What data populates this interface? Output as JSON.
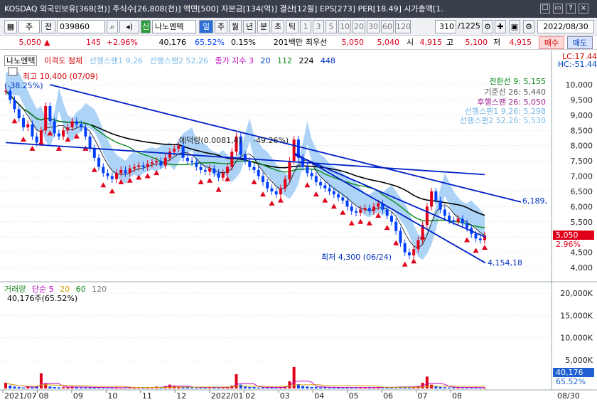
{
  "window": {
    "title": "KOSDAQ 외국인보유[368(천)] 주식수[26,808(천)] 액면[500] 자본금[134(억)] 결산[12월] EPS[273] PER[18.49] 시가총액[1.",
    "buttons": [
      "☐",
      "▭",
      "?",
      "×"
    ]
  },
  "toolbar": {
    "market": "주",
    "period_btn": "전",
    "code": "039860",
    "stock_name": "나노엔텍",
    "credit": "신",
    "mode_buttons": [
      "일",
      "주",
      "월",
      "년",
      "분",
      "초",
      "틱"
    ],
    "intervals": [
      "1",
      "3",
      "5",
      "10",
      "20",
      "30",
      "60",
      "120"
    ],
    "count": "310",
    "total": "/1225",
    "date": "2022/08/30"
  },
  "quote": {
    "price": "5,050",
    "change_arrow": "▲",
    "change": "145",
    "change_pct": "+2.96%",
    "volume": "40,176",
    "vol_ratio": "65.52%",
    "turnover": "0.15%",
    "amount": "201백만",
    "best_ask_label": "최우선",
    "best_ask": "5,050",
    "best_bid": "5,040",
    "open_label": "시",
    "open": "4,915",
    "high_label": "고",
    "high": "5,100",
    "low_label": "저",
    "low": "4,915",
    "buy_label": "매수",
    "sell_label": "매도"
  },
  "legend": {
    "stock": "나노엔텍",
    "overlay": "이격도 첨체",
    "span1": "선행스팬1 9,26",
    "span2": "선행스팬2 52,26",
    "ma_label": "종가 지수 3",
    "ma_periods": [
      "20",
      "112",
      "224",
      "448"
    ]
  },
  "stats": {
    "lc": "LC:17.44",
    "hc": "HC:-51.44"
  },
  "ichimoku_legend": [
    {
      "label": "전환선 9: 5,155",
      "color": "#0a8a1a"
    },
    {
      "label": "기준선 26: 5,440",
      "color": "#555555"
    },
    {
      "label": "후행스팬 26: 5,050",
      "color": "#9b1f8a"
    },
    {
      "label": "선행스팬1 9,26: 5,298",
      "color": "#7ab8e8"
    },
    {
      "label": "선행스팬2 52,26: 5,530",
      "color": "#7ab8e8"
    }
  ],
  "annotations": {
    "max": "최고 10,400 (07/09)",
    "max_pct": "(-38.25%)",
    "min": "최저 4,300 (06/24)",
    "trend_top": "6,189,",
    "trend_bottom": "4,154,18",
    "midlabel": "에덕량(0.0081,4)",
    "midpct": "-49.26%)",
    "last_price": "5,050",
    "last_pct": "2.96%"
  },
  "volume_panel": {
    "title": "거래량",
    "ma_label": "단순 5",
    "periods": [
      "20",
      "60",
      "120"
    ],
    "current": "40,176주(65.52%)",
    "last_volume": "40,176",
    "last_pct": "65.52%"
  },
  "colors": {
    "up": "#e0001a",
    "down": "#0040ff",
    "cloud": "#6ab0f0",
    "ma20": "#0a0a0a",
    "ma112": "#0a8a1a",
    "ma224": "#000000",
    "trend": "#0020c8"
  },
  "chart_data": {
    "type": "candlestick",
    "price_axis": {
      "min": 4000,
      "max": 10000,
      "ticks": [
        "10,000",
        "9,500",
        "9,000",
        "8,500",
        "8,000",
        "7,500",
        "7,000",
        "6,500",
        "6,000",
        "5,500",
        "5,000",
        "4,500",
        "4,000"
      ]
    },
    "volume_axis": {
      "ticks": [
        "20,000K",
        "15,000K",
        "10,000K",
        "5,000K"
      ]
    },
    "x_ticks": [
      "2021/07",
      "08",
      "09",
      "10",
      "11",
      "12",
      "2022/01",
      "02",
      "03",
      "04",
      "05",
      "06",
      "07",
      "08",
      "08/30"
    ],
    "close": [
      9800,
      9500,
      9200,
      8900,
      8600,
      8700,
      8300,
      8100,
      8500,
      9300,
      8800,
      8400,
      8300,
      8500,
      8600,
      8800,
      8700,
      8600,
      8300,
      7900,
      7600,
      7300,
      7100,
      7000,
      6900,
      7100,
      7200,
      7100,
      7250,
      7300,
      7350,
      7300,
      7400,
      7450,
      7500,
      7350,
      7600,
      7800,
      7900,
      8000,
      7600,
      7500,
      7450,
      7300,
      7200,
      7150,
      7250,
      7100,
      6950,
      7100,
      7300,
      7800,
      8300,
      7700,
      7500,
      7300,
      7200,
      7000,
      6800,
      6600,
      6500,
      6400,
      6600,
      6900,
      7500,
      8200,
      7600,
      7300,
      7100,
      7000,
      6800,
      6700,
      6600,
      6500,
      6400,
      6300,
      6200,
      6000,
      5850,
      5800,
      5900,
      5950,
      5850,
      6000,
      6100,
      5900,
      5700,
      5500,
      5200,
      4800,
      4500,
      4400,
      4600,
      4900,
      5400,
      6000,
      6500,
      6200,
      5900,
      5700,
      5550,
      5500,
      5600,
      5450,
      5300,
      5100,
      4950,
      4900,
      5050
    ],
    "volume_k": [
      1200,
      600,
      400,
      300,
      200,
      300,
      200,
      500,
      3200,
      1000,
      400,
      300,
      250,
      250,
      300,
      400,
      300,
      200,
      200,
      200,
      300,
      200,
      150,
      150,
      200,
      200,
      150,
      150,
      300,
      200,
      200,
      200,
      200,
      250,
      400,
      300,
      500,
      800,
      600,
      400,
      300,
      250,
      200,
      200,
      200,
      200,
      300,
      200,
      200,
      200,
      300,
      600,
      3000,
      800,
      400,
      300,
      300,
      200,
      200,
      200,
      200,
      200,
      300,
      400,
      1500,
      4500,
      900,
      500,
      400,
      300,
      300,
      250,
      250,
      200,
      200,
      200,
      200,
      250,
      200,
      200,
      200,
      200,
      200,
      200,
      300,
      300,
      200,
      200,
      300,
      400,
      400,
      300,
      300,
      500,
      1200,
      2500,
      800,
      500,
      300,
      250,
      200,
      200,
      200,
      200,
      200,
      200,
      200,
      150,
      150
    ]
  }
}
